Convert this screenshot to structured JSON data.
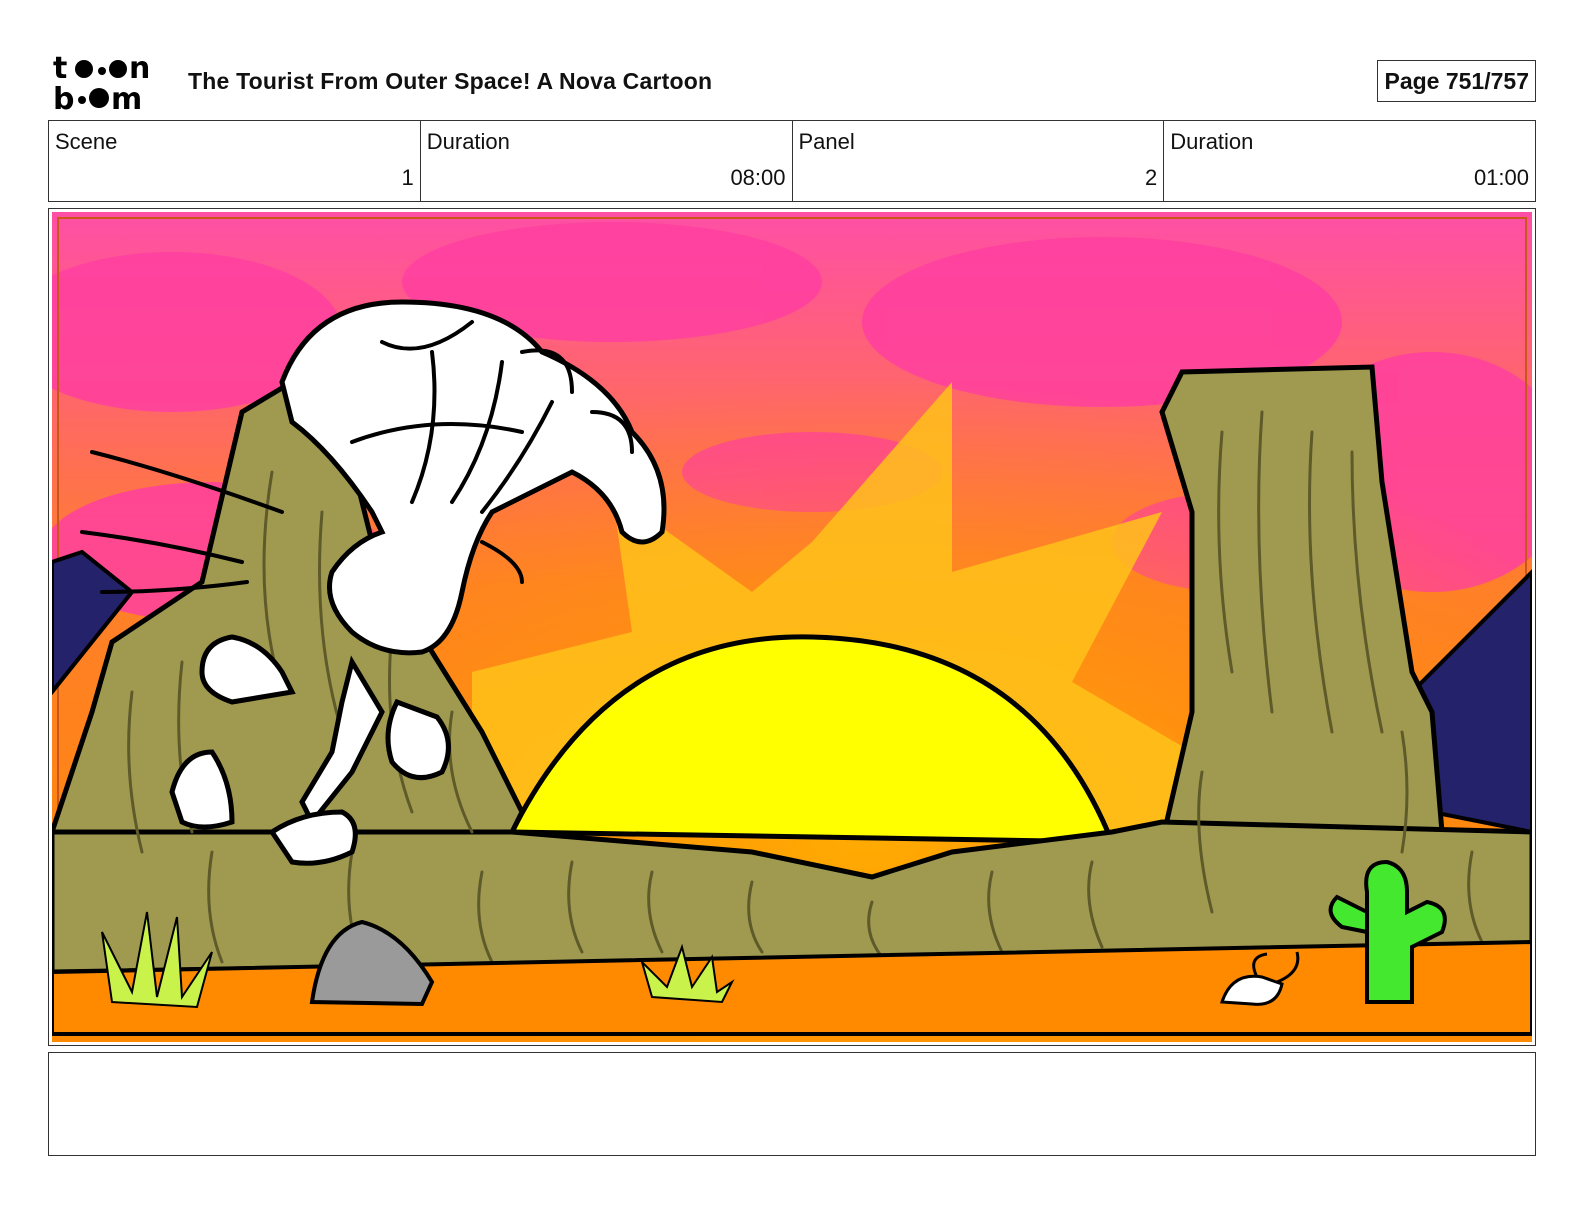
{
  "header": {
    "logo_text_top": "toon",
    "logo_text_bottom": "boom",
    "title": "The Tourist From Outer Space!  A Nova Cartoon",
    "page": "Page 751/757"
  },
  "info": [
    {
      "label": "Scene",
      "value": "1"
    },
    {
      "label": "Duration",
      "value": "08:00"
    },
    {
      "label": "Panel",
      "value": "2"
    },
    {
      "label": "Duration",
      "value": "01:00"
    }
  ],
  "panel": {
    "colors": {
      "sky_pink": "#ff3fa0",
      "sky_orange": "#ff8a00",
      "sun": "#ffff00",
      "ray": "#ffc21a",
      "rock": "#a09a50",
      "mountain": "#24226a",
      "ground": "#ff8a00",
      "cactus": "#44e82e",
      "stone": "#9a9a9a"
    }
  },
  "notes": {
    "text": ""
  }
}
